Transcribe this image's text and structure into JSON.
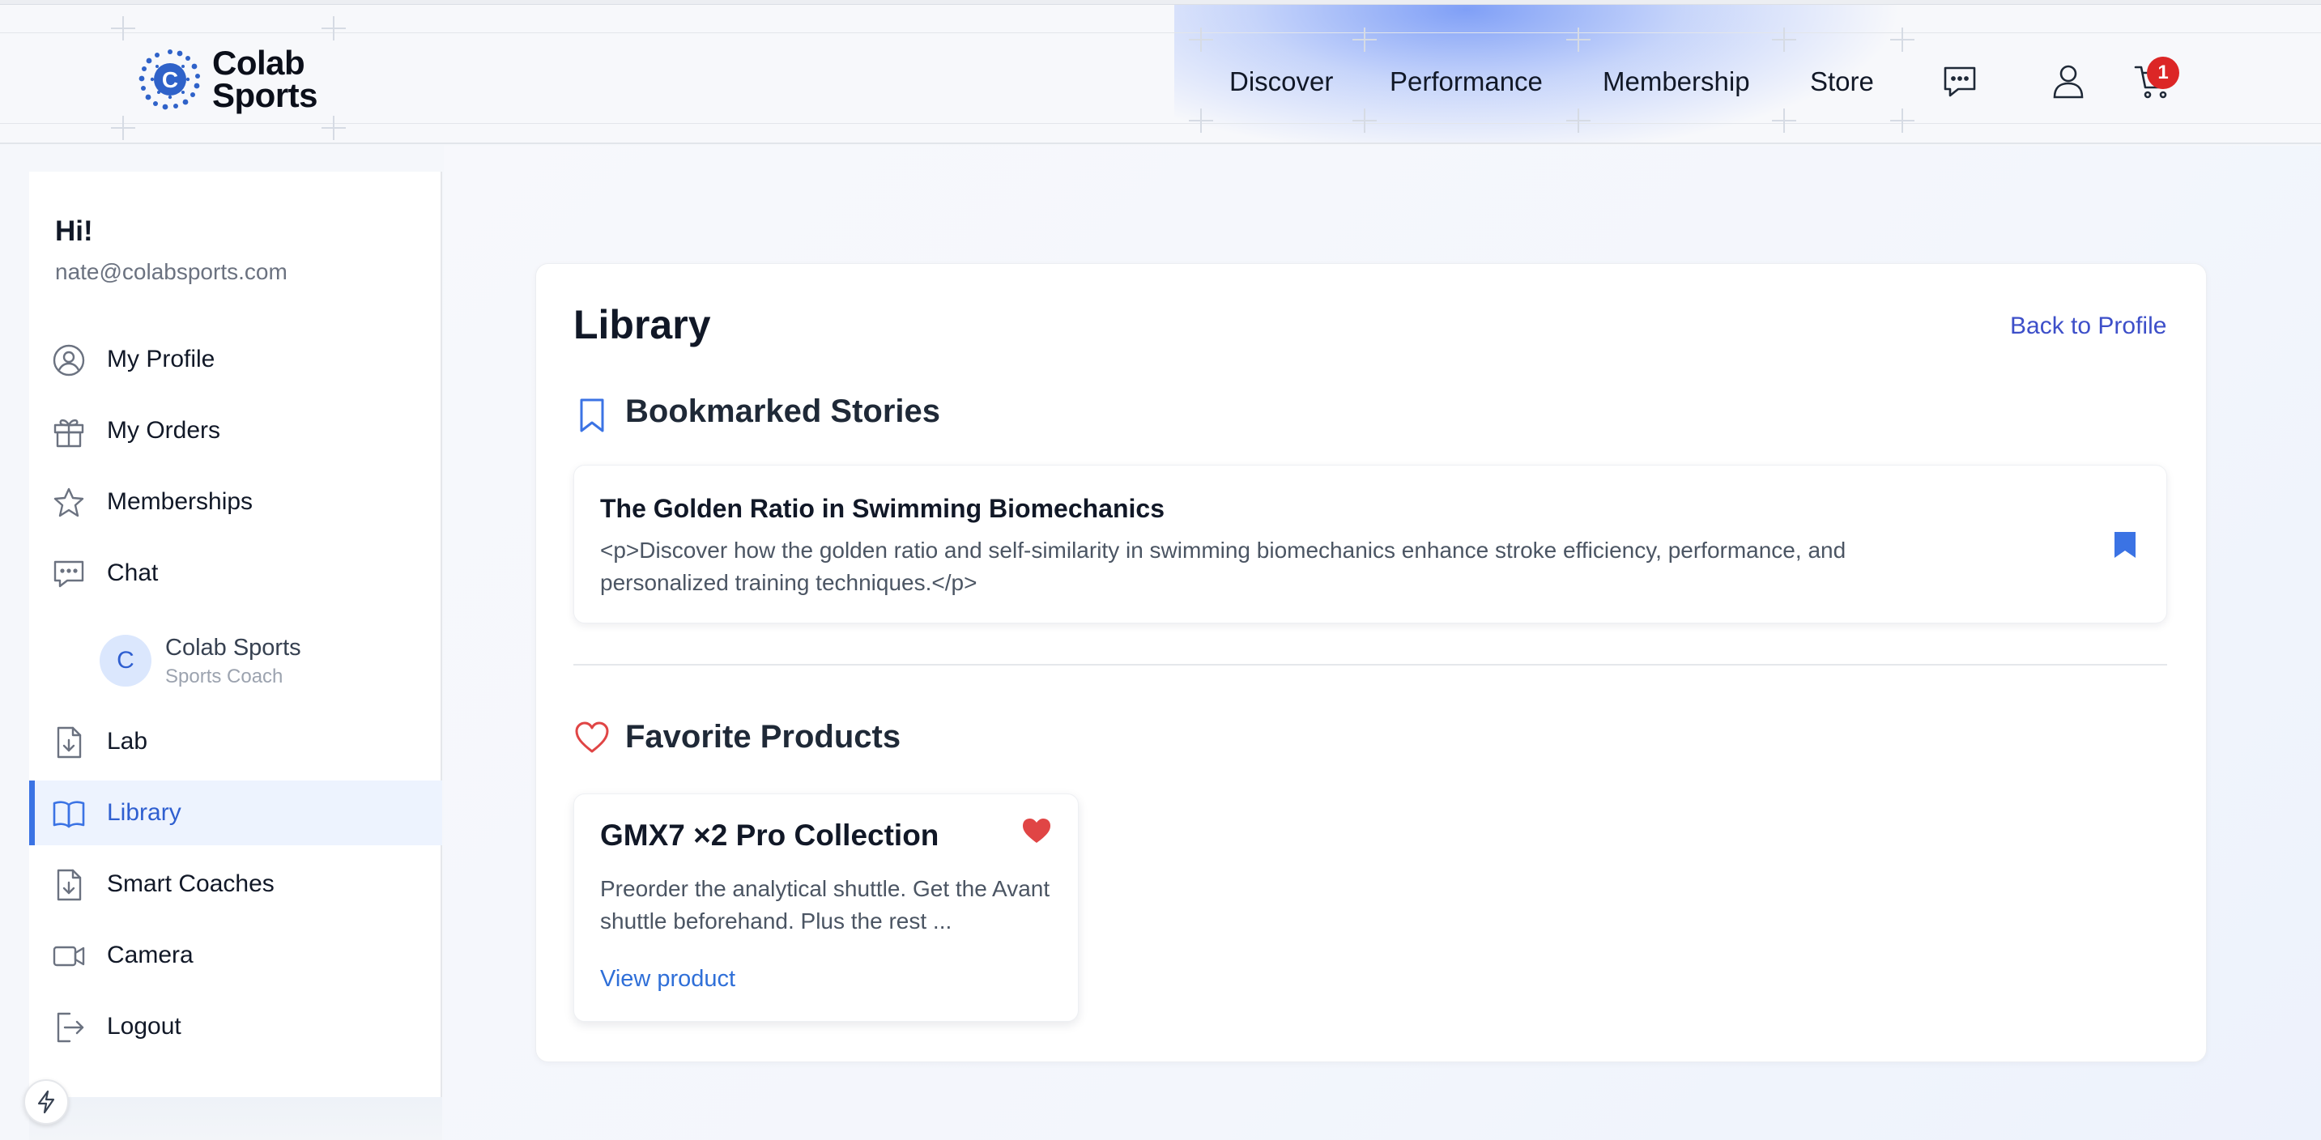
{
  "brand": {
    "name_line1": "Colab",
    "name_line2": "Sports",
    "logo_letter": "C"
  },
  "nav": [
    "Discover",
    "Performance",
    "Membership",
    "Store"
  ],
  "header": {
    "cart_count": "1"
  },
  "sidebar": {
    "greeting": "Hi!",
    "email": "nate@colabsports.com",
    "items": [
      {
        "label": "My Profile",
        "icon": "user-circle-icon"
      },
      {
        "label": "My Orders",
        "icon": "gift-icon"
      },
      {
        "label": "Memberships",
        "icon": "star-icon"
      },
      {
        "label": "Chat",
        "icon": "chat-icon"
      },
      {
        "label": "Lab",
        "icon": "file-download-icon"
      },
      {
        "label": "Library",
        "icon": "book-open-icon",
        "active": true
      },
      {
        "label": "Smart Coaches",
        "icon": "file-download-icon"
      },
      {
        "label": "Camera",
        "icon": "video-camera-icon"
      },
      {
        "label": "Logout",
        "icon": "logout-icon"
      }
    ],
    "chat_contact": {
      "avatar": "C",
      "name": "Colab Sports",
      "role": "Sports Coach"
    }
  },
  "library": {
    "title": "Library",
    "back_label": "Back to Profile",
    "bookmarks_title": "Bookmarked Stories",
    "story": {
      "title": "The Golden Ratio in Swimming Biomechanics",
      "description": "<p>Discover how the golden ratio and self-similarity in swimming biomechanics enhance stroke efficiency, performance, and personalized training techniques.</p>"
    },
    "favorites_title": "Favorite Products",
    "product": {
      "title": "GMX7 ×2 Pro Collection",
      "description": "Preorder the analytical shuttle. Get the Avant shuttle beforehand. Plus the rest ...",
      "link": "View product"
    }
  },
  "colors": {
    "accent": "#3b73e4",
    "heart": "#e04545",
    "link": "#3d4fc9",
    "badge": "#dc2626"
  }
}
